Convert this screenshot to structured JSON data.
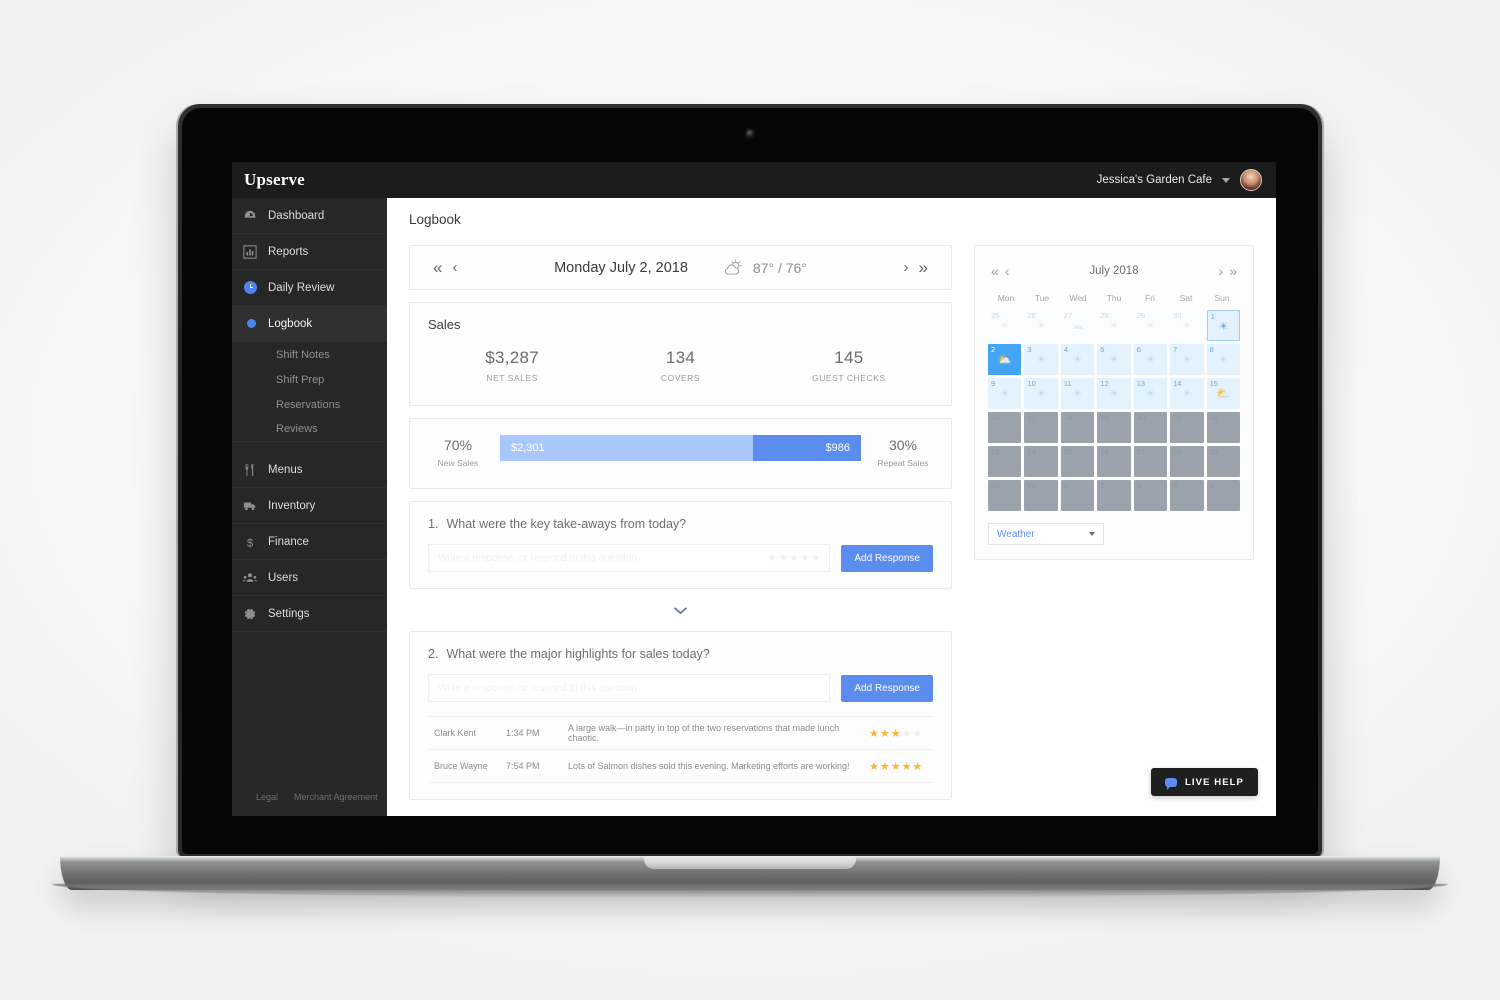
{
  "topbar": {
    "brand": "Upserve",
    "account_name": "Jessica's Garden Cafe"
  },
  "sidebar": {
    "items": [
      {
        "label": "Dashboard",
        "icon": "gauge-icon"
      },
      {
        "label": "Reports",
        "icon": "bar-chart-icon"
      },
      {
        "label": "Daily Review",
        "icon": "clock-icon"
      },
      {
        "label": "Logbook",
        "icon": "dot-icon",
        "active": true
      },
      {
        "label": "Menus",
        "icon": "cutlery-icon"
      },
      {
        "label": "Inventory",
        "icon": "truck-icon"
      },
      {
        "label": "Finance",
        "icon": "dollar-icon"
      },
      {
        "label": "Users",
        "icon": "people-icon"
      },
      {
        "label": "Settings",
        "icon": "gear-icon"
      }
    ],
    "sub_items": [
      {
        "label": "Shift Notes"
      },
      {
        "label": "Shift Prep"
      },
      {
        "label": "Reservations"
      },
      {
        "label": "Reviews"
      }
    ],
    "footer_links": [
      {
        "label": "Legal"
      },
      {
        "label": "Merchant Agreement"
      }
    ]
  },
  "page": {
    "title": "Logbook"
  },
  "datebar": {
    "first_label": "«",
    "prev_label": "‹",
    "date": "Monday July 2, 2018",
    "weather_icon": "partly-cloudy-icon",
    "temps": "87° / 76°",
    "next_label": "›",
    "last_label": "»"
  },
  "sales": {
    "title": "Sales",
    "stats": [
      {
        "value": "$3,287",
        "label": "NET SALES"
      },
      {
        "value": "134",
        "label": "COVERS"
      },
      {
        "value": "145",
        "label": "GUEST CHECKS"
      }
    ]
  },
  "split": {
    "left_percent": "70%",
    "left_label": "New Sales",
    "left_value": "$2,301",
    "right_percent": "30%",
    "right_label": "Repeat Sales",
    "right_value": "$986",
    "left_color": "#a9c7fa",
    "right_color": "#5b8def"
  },
  "questions": [
    {
      "number": "1.",
      "text": "What were the key take-aways from today?",
      "input_value": "",
      "placeholder": "Write a response, or respond to this question",
      "rating": 0,
      "max_rating": 5,
      "button_label": "Add Response",
      "comments": []
    },
    {
      "number": "2.",
      "text": "What were the major highlights for sales today?",
      "input_value": "",
      "placeholder": "Write a response, or respond to this question",
      "rating": 0,
      "max_rating": 5,
      "button_label": "Add Response",
      "comments": [
        {
          "name": "Clark Kent",
          "time": "1:34 PM",
          "text": "A large walk—in party in top of the two reservations that made lunch chaotic.",
          "rating": 3,
          "max_rating": 5
        },
        {
          "name": "Bruce Wayne",
          "time": "7:54 PM",
          "text": "Lots of Salmon dishes sold this evening.  Marketing efforts are working!",
          "rating": 5,
          "max_rating": 5
        }
      ]
    }
  ],
  "calendar": {
    "first_label": "«",
    "prev_label": "‹",
    "title": "July 2018",
    "next_label": "›",
    "last_label": "»",
    "dow": [
      "Mon",
      "Tue",
      "Wed",
      "Thu",
      "Fri",
      "Sat",
      "Sun"
    ],
    "days": [
      {
        "n": "25",
        "state": "out",
        "wx": "sun"
      },
      {
        "n": "26",
        "state": "out",
        "wx": "sun"
      },
      {
        "n": "27",
        "state": "out",
        "wx": "cloud"
      },
      {
        "n": "28",
        "state": "out",
        "wx": "sun"
      },
      {
        "n": "29",
        "state": "out",
        "wx": "sun"
      },
      {
        "n": "30",
        "state": "out",
        "wx": "sun"
      },
      {
        "n": "1",
        "state": "today",
        "wx": "sun"
      },
      {
        "n": "2",
        "state": "sel",
        "wx": "partly"
      },
      {
        "n": "3",
        "state": "avail",
        "wx": "sun"
      },
      {
        "n": "4",
        "state": "avail",
        "wx": "sun"
      },
      {
        "n": "5",
        "state": "avail",
        "wx": "sun"
      },
      {
        "n": "6",
        "state": "avail",
        "wx": "sun"
      },
      {
        "n": "7",
        "state": "avail",
        "wx": "sun"
      },
      {
        "n": "8",
        "state": "avail",
        "wx": "sun"
      },
      {
        "n": "9",
        "state": "avail",
        "wx": "sun"
      },
      {
        "n": "10",
        "state": "avail",
        "wx": "sun"
      },
      {
        "n": "11",
        "state": "avail",
        "wx": "sun"
      },
      {
        "n": "12",
        "state": "avail",
        "wx": "sun"
      },
      {
        "n": "13",
        "state": "avail",
        "wx": "sun"
      },
      {
        "n": "14",
        "state": "avail",
        "wx": "sun"
      },
      {
        "n": "15",
        "state": "avail",
        "wx": "partly"
      },
      {
        "n": "16",
        "state": "off",
        "wx": ""
      },
      {
        "n": "17",
        "state": "off",
        "wx": ""
      },
      {
        "n": "18",
        "state": "off",
        "wx": ""
      },
      {
        "n": "19",
        "state": "off",
        "wx": ""
      },
      {
        "n": "20",
        "state": "off",
        "wx": ""
      },
      {
        "n": "21",
        "state": "off",
        "wx": ""
      },
      {
        "n": "22",
        "state": "off",
        "wx": ""
      },
      {
        "n": "23",
        "state": "off",
        "wx": ""
      },
      {
        "n": "24",
        "state": "off",
        "wx": ""
      },
      {
        "n": "25",
        "state": "off",
        "wx": ""
      },
      {
        "n": "26",
        "state": "off",
        "wx": ""
      },
      {
        "n": "27",
        "state": "off",
        "wx": ""
      },
      {
        "n": "28",
        "state": "off",
        "wx": ""
      },
      {
        "n": "29",
        "state": "off",
        "wx": ""
      },
      {
        "n": "30",
        "state": "off",
        "wx": ""
      },
      {
        "n": "31",
        "state": "off",
        "wx": ""
      },
      {
        "n": "1",
        "state": "off",
        "wx": ""
      },
      {
        "n": "2",
        "state": "off",
        "wx": ""
      },
      {
        "n": "3",
        "state": "off",
        "wx": ""
      },
      {
        "n": "4",
        "state": "off",
        "wx": ""
      },
      {
        "n": "5",
        "state": "off",
        "wx": ""
      }
    ],
    "select_value": "Weather"
  },
  "live_help": {
    "label": "LIVE HELP",
    "icon": "chat-bubble-icon"
  },
  "colors": {
    "accent": "#5b8def",
    "accent_light": "#a9c7fa",
    "sidebar_bg": "#272727",
    "topbar_bg": "#1c1c1c",
    "star": "#fbb338"
  }
}
